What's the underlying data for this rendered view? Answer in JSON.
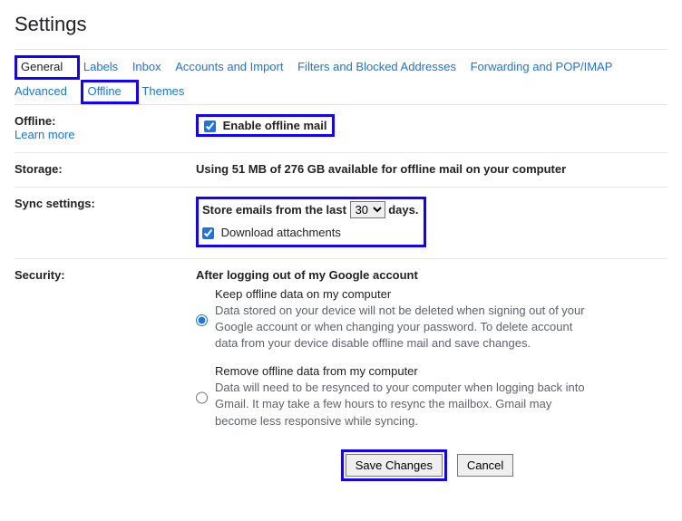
{
  "page_title": "Settings",
  "tabs": {
    "general": "General",
    "labels": "Labels",
    "inbox": "Inbox",
    "accounts": "Accounts and Import",
    "filters": "Filters and Blocked Addresses",
    "forwarding": "Forwarding and POP/IMAP",
    "advanced": "Advanced",
    "offline": "Offline",
    "themes": "Themes"
  },
  "offline": {
    "label": "Offline:",
    "learn_more": "Learn more",
    "enable_label": "Enable offline mail"
  },
  "storage": {
    "label": "Storage:",
    "text": "Using 51 MB of 276 GB available for offline mail on your computer"
  },
  "sync": {
    "label": "Sync settings:",
    "store_prefix": "Store emails from the last",
    "store_suffix": "days.",
    "days_value": "30",
    "download_label": "Download attachments"
  },
  "security": {
    "label": "Security:",
    "heading": "After logging out of my Google account",
    "keep_title": "Keep offline data on my computer",
    "keep_desc": "Data stored on your device will not be deleted when signing out of your Google account or when changing your password. To delete account data from your device disable offline mail and save changes.",
    "remove_title": "Remove offline data from my computer",
    "remove_desc": "Data will need to be resynced to your computer when logging back into Gmail. It may take a few hours to resync the mailbox. Gmail may become less responsive while syncing."
  },
  "buttons": {
    "save": "Save Changes",
    "cancel": "Cancel"
  }
}
